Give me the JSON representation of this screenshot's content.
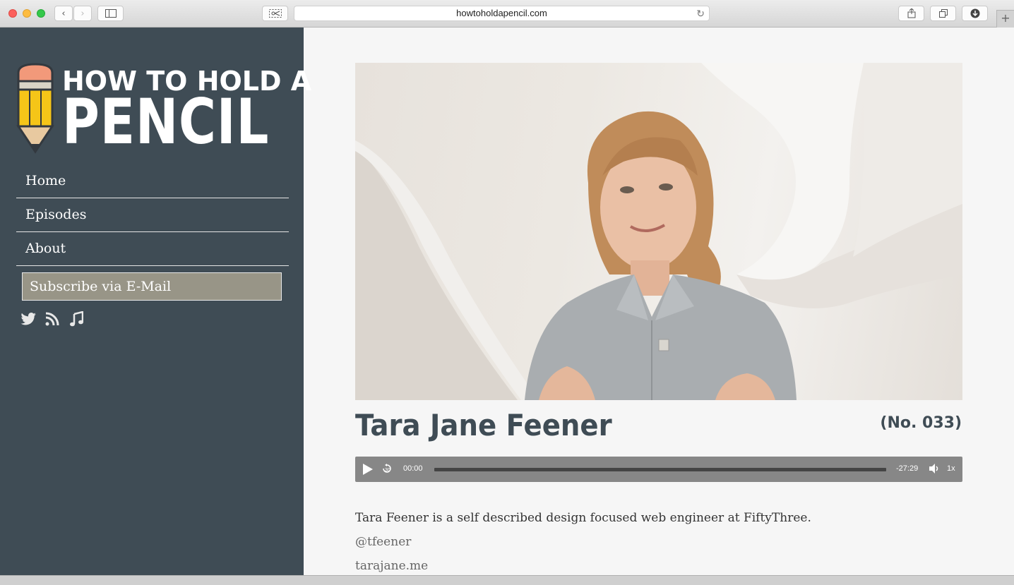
{
  "browser": {
    "url": "howtoholdapencil.com"
  },
  "logo": {
    "line1": "HOW TO HOLD A",
    "line2": "PENCIL"
  },
  "nav": {
    "items": [
      {
        "label": "Home"
      },
      {
        "label": "Episodes"
      },
      {
        "label": "About"
      }
    ],
    "subscribe_label": "Subscribe via E-Mail"
  },
  "social": {
    "icons": [
      "twitter-icon",
      "rss-icon",
      "music-icon"
    ]
  },
  "episode": {
    "title": "Tara Jane Feener",
    "number": "(No. 033)",
    "description": "Tara Feener is a self described design focused web engineer at FiftyThree.",
    "links": [
      "@tfeener",
      "tarajane.me"
    ]
  },
  "player": {
    "skip_label": "30",
    "current_time": "00:00",
    "remaining_time": "-27:29",
    "speed": "1x",
    "progress": 0
  },
  "colors": {
    "sidebar": "#3f4c55",
    "subscribe": "#989587",
    "pencil_yellow": "#f5c518",
    "pencil_eraser": "#f2997a"
  }
}
